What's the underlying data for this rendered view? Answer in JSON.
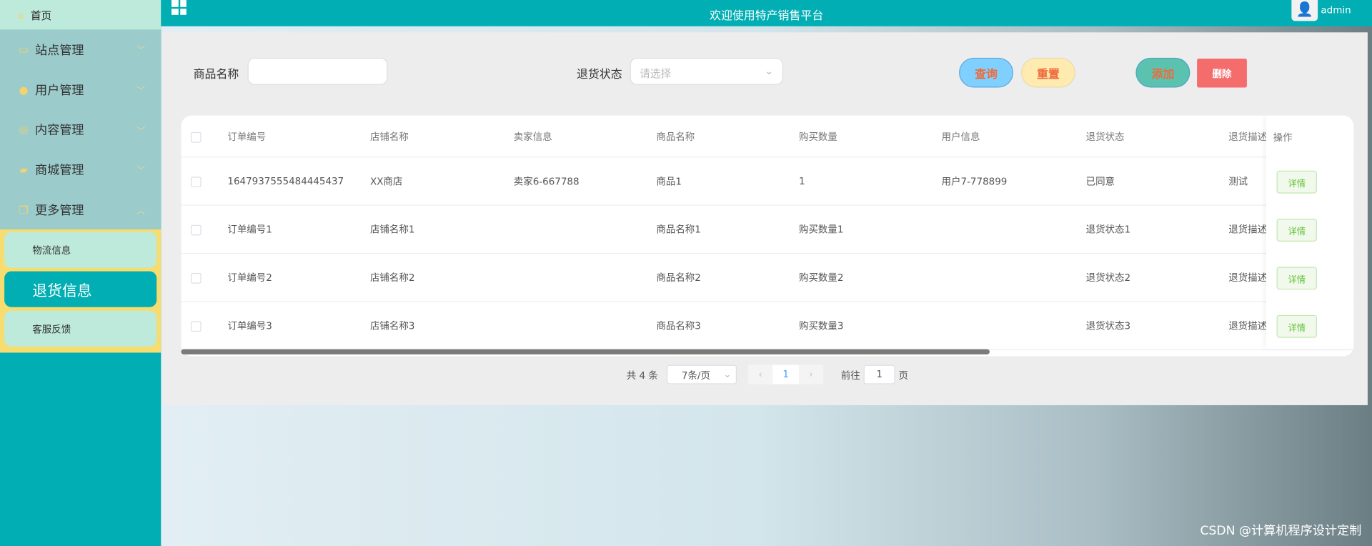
{
  "header": {
    "title": "欢迎使用特产销售平台",
    "username": "admin"
  },
  "sidebar": {
    "home": "首页",
    "menus": [
      {
        "label": "站点管理",
        "icon": "screen-icon"
      },
      {
        "label": "用户管理",
        "icon": "user-icon"
      },
      {
        "label": "内容管理",
        "icon": "chat-icon"
      },
      {
        "label": "商城管理",
        "icon": "bag-icon"
      },
      {
        "label": "更多管理",
        "icon": "copy-icon"
      }
    ],
    "sub_items": [
      "物流信息",
      "退货信息",
      "客服反馈"
    ]
  },
  "search": {
    "product_label": "商品名称",
    "product_value": "",
    "status_label": "退货状态",
    "status_placeholder": "请选择",
    "query": "查询",
    "reset": "重置",
    "add": "添加",
    "delete": "删除"
  },
  "table": {
    "columns": [
      "订单编号",
      "店铺名称",
      "卖家信息",
      "商品名称",
      "购买数量",
      "用户信息",
      "退货状态",
      "退货描述",
      "操作"
    ],
    "rows": [
      [
        "1647937555484445437",
        "XX商店",
        "卖家6-667788",
        "商品1",
        "1",
        "用户7-778899",
        "已同意",
        "测试"
      ],
      [
        "订单编号1",
        "店铺名称1",
        "",
        "商品名称1",
        "购买数量1",
        "",
        "退货状态1",
        "退货描述"
      ],
      [
        "订单编号2",
        "店铺名称2",
        "",
        "商品名称2",
        "购买数量2",
        "",
        "退货状态2",
        "退货描述"
      ],
      [
        "订单编号3",
        "店铺名称3",
        "",
        "商品名称3",
        "购买数量3",
        "",
        "退货状态3",
        "退货描述"
      ]
    ],
    "detail_label": "详情"
  },
  "pagination": {
    "total": "共 4 条",
    "page_size": "7条/页",
    "current_page": "1",
    "goto_label": "前往",
    "goto_value": "1",
    "page_suffix": "页"
  },
  "watermark": "CSDN @计算机程序设计定制"
}
